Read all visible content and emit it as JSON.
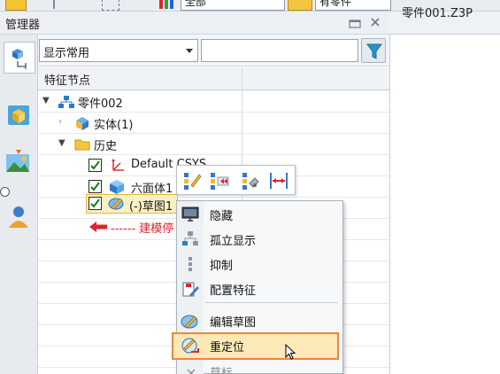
{
  "toolbar": {
    "combo_label": "全部",
    "search_label": "有零件"
  },
  "panel": {
    "title": "管理器"
  },
  "document": {
    "tab_label": "零件001.Z3P"
  },
  "filter": {
    "selected": "显示常用",
    "search_placeholder": ""
  },
  "tree": {
    "column_header": "特征节点",
    "root_label": "零件002",
    "solid_label": "实体(1)",
    "history_label": "历史",
    "csys_label": "Default CSYS",
    "box_label": "六面体1",
    "sketch_label": "(-)草图1",
    "rebuild_hint": "------ 建模停"
  },
  "context_menu": {
    "items": [
      {
        "label": "隐藏",
        "icon": "monitor-hide-icon"
      },
      {
        "label": "孤立显示",
        "icon": "isolate-icon"
      },
      {
        "label": "抑制",
        "icon": "suppress-icon"
      },
      {
        "label": "配置特征",
        "icon": "configure-feature-icon"
      },
      {
        "label": "编辑草图",
        "icon": "edit-sketch-icon"
      },
      {
        "label": "重定位",
        "icon": "reposition-icon"
      },
      {
        "label": "草标",
        "icon": "partial-icon"
      }
    ]
  },
  "colors": {
    "accent_orange": "#e8873a",
    "selection_yellow": "#f9f0c6",
    "arrow_red": "#d9262c"
  }
}
